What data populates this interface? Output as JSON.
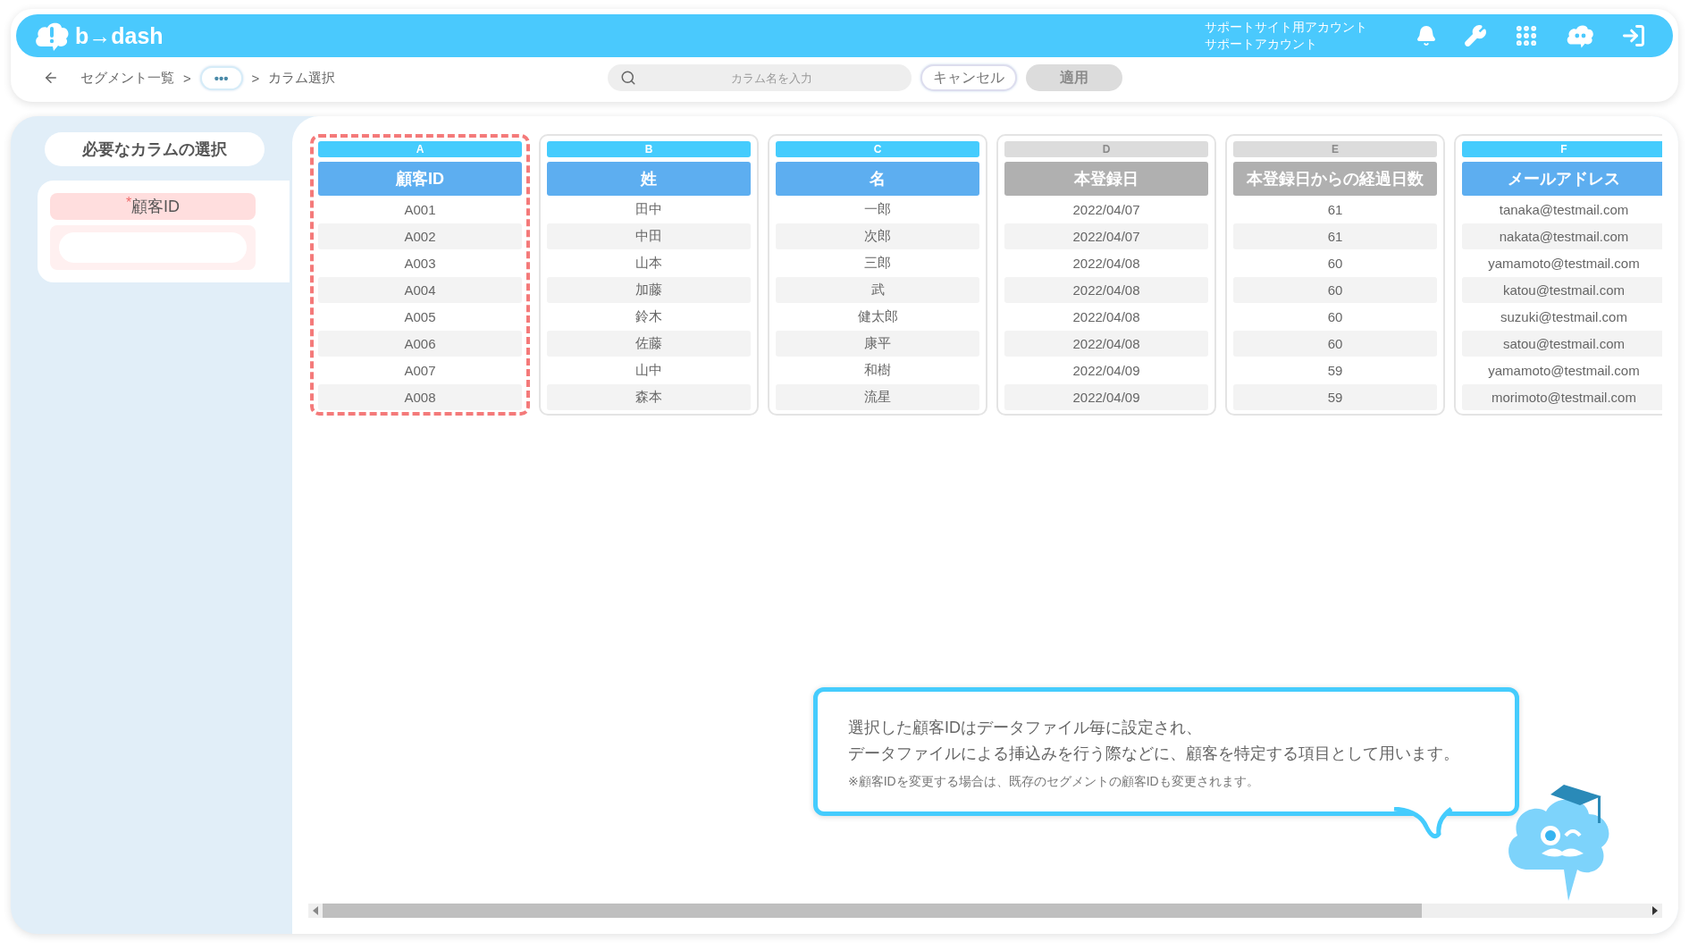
{
  "header": {
    "logo": "b→dash",
    "account_lines": [
      "サポートサイト用アカウント",
      "サポートアカウント"
    ]
  },
  "breadcrumb": {
    "items": [
      {
        "kind": "link",
        "label": "セグメント一覧"
      },
      {
        "kind": "separator",
        "label": ">"
      },
      {
        "kind": "more",
        "label": "•••"
      },
      {
        "kind": "separator",
        "label": ">"
      },
      {
        "kind": "current",
        "label": "カラム選択"
      }
    ]
  },
  "search": {
    "placeholder": "カラム名を入力"
  },
  "buttons": [
    {
      "label": "キャンセル",
      "kind": "outline"
    },
    {
      "label": "適用",
      "kind": "primary",
      "disabled": true
    }
  ],
  "sidebar": {
    "title": "必要なカラムの選択",
    "fields": [
      {
        "required_mark": "*",
        "label": "顧客ID"
      }
    ]
  },
  "columns": [
    {
      "letter": "A",
      "title": "顧客ID",
      "enabled": true,
      "highlighted": true,
      "cells": [
        "A001",
        "A002",
        "A003",
        "A004",
        "A005",
        "A006",
        "A007",
        "A008"
      ]
    },
    {
      "letter": "B",
      "title": "姓",
      "enabled": true,
      "highlighted": false,
      "cells": [
        "田中",
        "中田",
        "山本",
        "加藤",
        "鈴木",
        "佐藤",
        "山中",
        "森本"
      ]
    },
    {
      "letter": "C",
      "title": "名",
      "enabled": true,
      "highlighted": false,
      "cells": [
        "一郎",
        "次郎",
        "三郎",
        "武",
        "健太郎",
        "康平",
        "和樹",
        "流星"
      ]
    },
    {
      "letter": "D",
      "title": "本登録日",
      "enabled": false,
      "highlighted": false,
      "cells": [
        "2022/04/07",
        "2022/04/07",
        "2022/04/08",
        "2022/04/08",
        "2022/04/08",
        "2022/04/08",
        "2022/04/09",
        "2022/04/09"
      ]
    },
    {
      "letter": "E",
      "title": "本登録日からの経過日数",
      "enabled": false,
      "highlighted": false,
      "cells": [
        "61",
        "61",
        "60",
        "60",
        "60",
        "60",
        "59",
        "59"
      ]
    },
    {
      "letter": "F",
      "title": "メールアドレス",
      "enabled": true,
      "highlighted": false,
      "cells": [
        "tanaka@testmail.com",
        "nakata@testmail.com",
        "yamamoto@testmail.com",
        "katou@testmail.com",
        "suzuki@testmail.com",
        "satou@testmail.com",
        "yamamoto@testmail.com",
        "morimoto@testmail.com"
      ]
    }
  ],
  "hint": {
    "lines": [
      "選択した顧客IDはデータファイル毎に設定され、",
      "データファイルによる挿込みを行う際などに、顧客を特定する項目として用います。"
    ],
    "note": "※顧客IDを変更する場合は、既存のセグメントの顧客IDも変更されます。"
  }
}
